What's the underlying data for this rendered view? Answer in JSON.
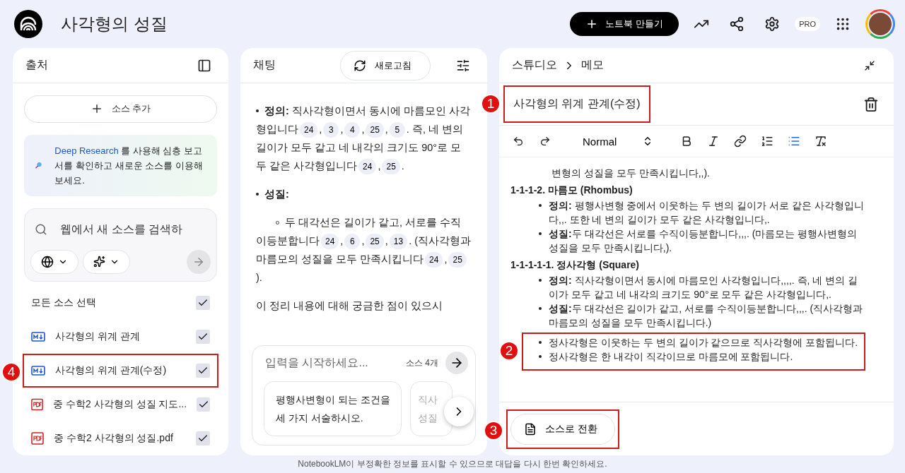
{
  "app": {
    "title": "사각형의 성질",
    "create_button": "노트북 만들기",
    "plan_badge": "PRO"
  },
  "sources": {
    "title": "출처",
    "add_button": "소스 추가",
    "promo": {
      "link": "Deep Research",
      "text": " 를 사용해 심층 보고서를 확인하고 새로운 소스를 이용해 보세요."
    },
    "search": {
      "placeholder": "웹에서 새 소스를 검색하"
    },
    "select_all": {
      "label": "모든 소스 선택",
      "checked": true
    },
    "items": [
      {
        "kind": "md",
        "label": "사각형의 위계 관계",
        "checked": true
      },
      {
        "kind": "md",
        "label": "사각형의 위계 관계(수정)",
        "checked": true,
        "callout": "4"
      },
      {
        "kind": "pdf",
        "label": "중 수학2 사각형의 성질 지도...",
        "checked": true
      },
      {
        "kind": "pdf",
        "label": "중 수학2 사각형의 성질.pdf",
        "checked": true
      }
    ]
  },
  "chat": {
    "title": "채팅",
    "refresh_button": "새로고침",
    "blocks": [
      {
        "kind": "bullet",
        "parts": [
          {
            "kind": "text",
            "text": "**정의:** 직사각형이면서 동시에 마름모인 사각형입니다"
          },
          {
            "kind": "cite",
            "text": "24"
          },
          {
            "kind": "text",
            "text": ","
          },
          {
            "kind": "cite",
            "text": "3"
          },
          {
            "kind": "text",
            "text": ","
          },
          {
            "kind": "cite",
            "text": "4"
          },
          {
            "kind": "text",
            "text": ","
          },
          {
            "kind": "cite",
            "text": "25"
          },
          {
            "kind": "text",
            "text": ","
          },
          {
            "kind": "cite",
            "text": "5"
          },
          {
            "kind": "text",
            "text": ". 즉, 네 변의 길이가 모두 같고 네 내각의 크기도 90°로 모두 같은 사각형입니다"
          },
          {
            "kind": "cite",
            "text": "24"
          },
          {
            "kind": "text",
            "text": ","
          },
          {
            "kind": "cite",
            "text": "25"
          },
          {
            "kind": "text",
            "text": "."
          }
        ]
      },
      {
        "kind": "bullet",
        "parts": [
          {
            "kind": "text",
            "text": "**성질:**"
          }
        ]
      },
      {
        "kind": "subbullet",
        "parts": [
          {
            "kind": "text",
            "text": "두 대각선은 길이가 같고, 서로를 수직이등분합니다"
          },
          {
            "kind": "cite",
            "text": "24"
          },
          {
            "kind": "text",
            "text": ","
          },
          {
            "kind": "cite",
            "text": "6"
          },
          {
            "kind": "text",
            "text": ","
          },
          {
            "kind": "cite",
            "text": "25"
          },
          {
            "kind": "text",
            "text": ","
          },
          {
            "kind": "cite",
            "text": "13"
          },
          {
            "kind": "text",
            "text": ". (직사각형과 마름모의 성질을 모두 만족시킵니다"
          },
          {
            "kind": "cite",
            "text": "24"
          },
          {
            "kind": "text",
            "text": ","
          },
          {
            "kind": "cite",
            "text": "25"
          },
          {
            "kind": "text",
            "text": ")."
          }
        ]
      },
      {
        "kind": "plain",
        "parts": [
          {
            "kind": "text",
            "text": "이 정리 내용에 대해 궁금한 점이 있으시"
          }
        ]
      }
    ],
    "input": {
      "placeholder": "입력을 시작하세요...",
      "source_count": "소스 4개"
    },
    "suggestions": [
      {
        "lines": [
          "평행사변형이 되는 조건을",
          "세 가지 서술하시오."
        ]
      },
      {
        "lines": [
          "직사",
          "성질"
        ]
      }
    ]
  },
  "studio": {
    "crumb": "스튜디오",
    "page": "메모",
    "note_title": {
      "text": "사각형의 위계 관계(수정)",
      "callout": "1"
    },
    "format": "Normal",
    "tools": [
      {
        "kind": "bold",
        "active": false
      },
      {
        "kind": "italic",
        "active": false
      },
      {
        "kind": "link",
        "active": false
      },
      {
        "kind": "ordered",
        "active": false
      },
      {
        "kind": "bullets",
        "active": true
      },
      {
        "kind": "clear",
        "active": false
      }
    ],
    "blocks": [
      {
        "kind": "continuation",
        "text": "변형의 성질을 모두 만족시킵니다,,)."
      },
      {
        "kind": "heading",
        "text": "1-1-1-2. 마름모 (Rhombus)"
      },
      {
        "kind": "bullet",
        "text": "**정의:** 평행사변형 중에서 이웃하는 두 변의 길이가 서로 같은 사각형입니다,,. 또한 네 변의 길이가 모두 같은 사각형입니다,."
      },
      {
        "kind": "bullet",
        "text": "**성질:**두 대각선은 서로를 수직이등분합니다,,,. (마름모는 평행사변형의 성질을 모두 만족시킵니다,)."
      },
      {
        "kind": "heading",
        "text": "1-1-1-1-1. 정사각형 (Square)"
      },
      {
        "kind": "bullet",
        "text": "**정의:** 직사각형이면서 동시에 마름모인 사각형입니다,,,,. 즉, 네 변의 길이가 모두 같고 네 내각의 크기도 90°로 모두 같은 사각형입니다,."
      },
      {
        "kind": "bullet",
        "text": "**성질:**두 대각선은 길이가 같고, 서로를 수직이등분합니다,,,. (직사각형과 마름모의 성질을 모두 만족시킵니다.)"
      }
    ],
    "highlight": {
      "callout": "2",
      "items": [
        "정사각형은 이웃하는 두 변의 길이가 같으므로 직사각형에 포함됩니다.",
        "정사각형은 한 내각이 직각이므로 마름모에 포함됩니다."
      ]
    },
    "convert_button": {
      "label": "소스로 전환",
      "callout": "3"
    }
  },
  "footer": "NotebookLM이 부정확한 정보를 표시할 수 있으므로 대답을 다시 한번 확인하세요."
}
